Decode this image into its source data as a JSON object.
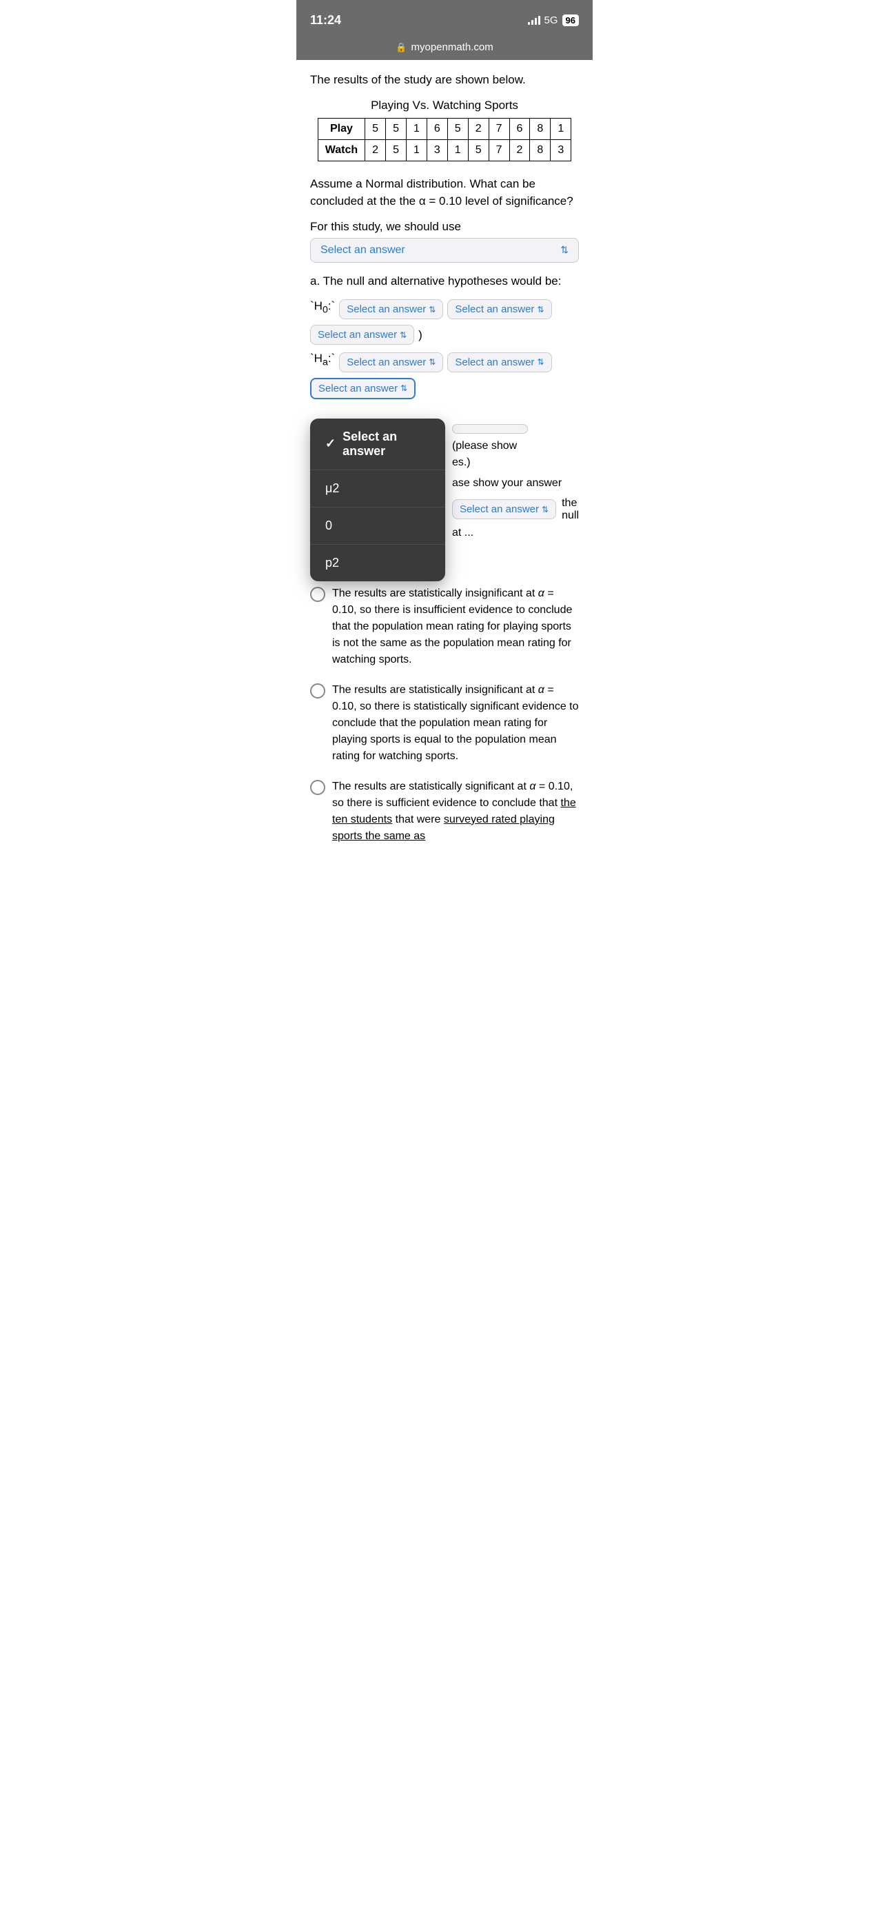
{
  "statusBar": {
    "time": "11:24",
    "signal": "5G",
    "battery": "96"
  },
  "urlBar": {
    "url": "myopenmath.com"
  },
  "intro": {
    "text": "The results of the study are shown below."
  },
  "table": {
    "title": "Playing Vs. Watching Sports",
    "headers": [
      "Play",
      "Watch"
    ],
    "playData": [
      "5",
      "5",
      "1",
      "6",
      "5",
      "2",
      "7",
      "6",
      "8",
      "1"
    ],
    "watchData": [
      "2",
      "5",
      "1",
      "3",
      "1",
      "5",
      "7",
      "2",
      "8",
      "3"
    ]
  },
  "question": {
    "text": "Assume a Normal distribution.  What can be concluded at the the α = 0.10 level of significance?"
  },
  "studyLabel": "For this study, we should use",
  "mainSelect": {
    "placeholder": "Select an answer"
  },
  "hypothesesTitle": "a.  The null and alternative hypotheses would be:",
  "h0Label": "`H₀:`",
  "haLabel": "`Hₐ:`",
  "selectPlaceholder": "Select an answer",
  "dropdown": {
    "items": [
      {
        "label": "Select an answer",
        "isSelected": true
      },
      {
        "label": "μ2",
        "isSelected": false
      },
      {
        "label": "0",
        "isSelected": false
      },
      {
        "label": "p2",
        "isSelected": false
      }
    ]
  },
  "partialContent": {
    "pleaseShow": "(please show",
    "es": "es.)",
    "aseShowAnswer": "ase show your answer",
    "theNull": "the null",
    "atDots": "at ..."
  },
  "radioOptions": [
    {
      "id": "opt1",
      "text": "The results are statistically insignificant at α = 0.10, so there is insufficient evidence to conclude that the population mean rating for playing sports is not the same as the population mean rating for watching sports."
    },
    {
      "id": "opt2",
      "text": "The results are statistically insignificant at α = 0.10, so there is statistically significant evidence to conclude that the population mean rating for playing sports is equal to the population mean rating for watching sports."
    },
    {
      "id": "opt3",
      "text": "The results are statistically significant at α = 0.10, so there is sufficient evidence to conclude that the ten students that were surveyed rated playing sports the same as"
    }
  ]
}
